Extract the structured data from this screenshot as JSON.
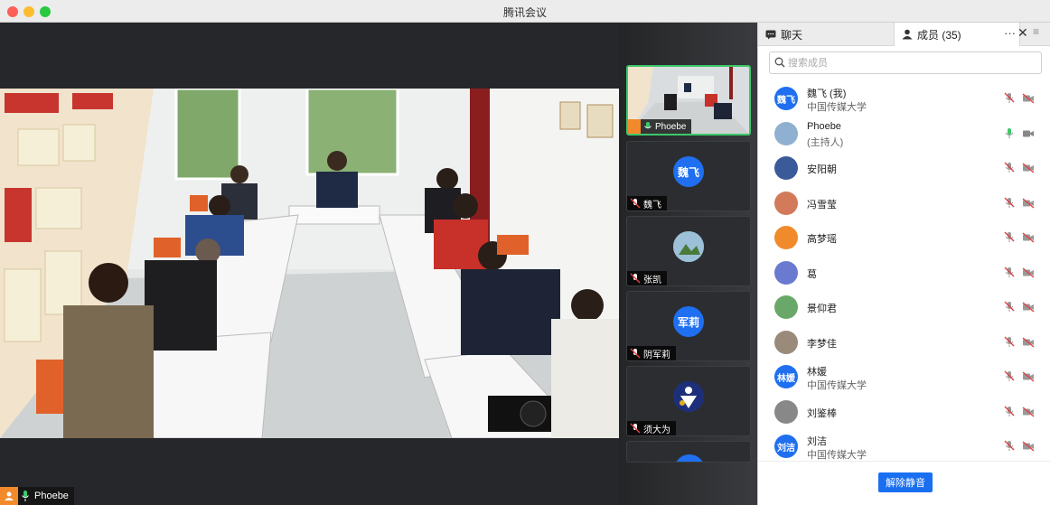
{
  "window": {
    "title": "腾讯会议"
  },
  "main": {
    "speaker_name": "Phoebe"
  },
  "strip": {
    "tiles": [
      {
        "name": "Phoebe",
        "initials": ""
      },
      {
        "name": "魏飞",
        "initials": "魏飞"
      },
      {
        "name": "张凯",
        "initials": ""
      },
      {
        "name": "阴军莉",
        "initials": "军莉"
      },
      {
        "name": "须大为",
        "initials": ""
      }
    ]
  },
  "panel": {
    "tab_chat": "聊天",
    "tab_members": "成员 (35)",
    "search_placeholder": "搜索成员",
    "unmute_label": "解除静音",
    "members": [
      {
        "name": "魏飞 (我)",
        "sub": "中国传媒大学",
        "avatar_text": "魏飞",
        "avatar_color": "#1f6ff0"
      },
      {
        "name": "Phoebe",
        "sub": "(主持人)",
        "avatar_text": "",
        "avatar_color": "#8fb0d0"
      },
      {
        "name": "安阳朝",
        "sub": "",
        "avatar_text": "",
        "avatar_color": "#3a5a9a"
      },
      {
        "name": "冯雪莹",
        "sub": "",
        "avatar_text": "",
        "avatar_color": "#d27a5a"
      },
      {
        "name": "高梦瑶",
        "sub": "",
        "avatar_text": "",
        "avatar_color": "#f08a2a"
      },
      {
        "name": "葛",
        "sub": "",
        "avatar_text": "",
        "avatar_color": "#6a7ad0"
      },
      {
        "name": "景仰君",
        "sub": "",
        "avatar_text": "",
        "avatar_color": "#6aa86a"
      },
      {
        "name": "李梦佳",
        "sub": "",
        "avatar_text": "",
        "avatar_color": "#9a8a7a"
      },
      {
        "name": "林媛",
        "sub": "中国传媒大学",
        "avatar_text": "林媛",
        "avatar_color": "#1f6ff0"
      },
      {
        "name": "刘鉴棒",
        "sub": "",
        "avatar_text": "",
        "avatar_color": "#888888"
      },
      {
        "name": "刘洁",
        "sub": "中国传媒大学",
        "avatar_text": "刘洁",
        "avatar_color": "#1f6ff0"
      }
    ]
  }
}
